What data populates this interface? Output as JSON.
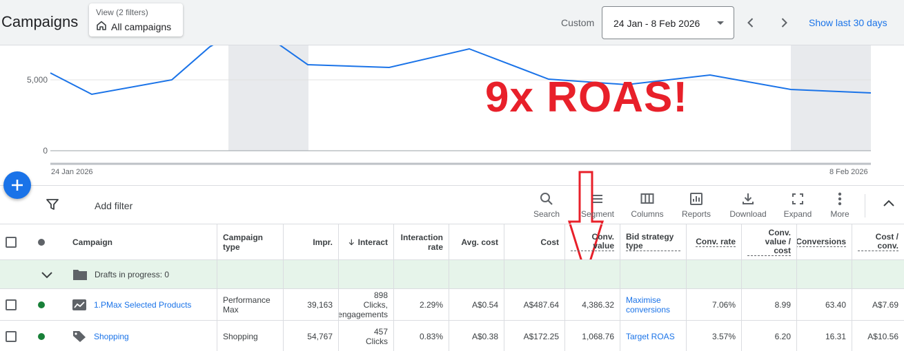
{
  "header": {
    "title": "Campaigns",
    "view_sub": "View (2 filters)",
    "view_main": "All campaigns",
    "custom_label": "Custom",
    "date_range": "24 Jan - 8 Feb 2026",
    "show_last": "Show last 30 days"
  },
  "chart": {
    "yticks": [
      "5,000",
      "0"
    ],
    "x_start": "24 Jan 2026",
    "x_end": "8 Feb 2026",
    "annotation": "9x ROAS!",
    "line_color": "#1a73e8",
    "annotation_color": "#e8202a"
  },
  "toolbar": {
    "add_filter": "Add filter",
    "tools": [
      {
        "label": "Search",
        "icon": "search-icon"
      },
      {
        "label": "Segment",
        "icon": "segment-icon"
      },
      {
        "label": "Columns",
        "icon": "columns-icon"
      },
      {
        "label": "Reports",
        "icon": "reports-icon"
      },
      {
        "label": "Download",
        "icon": "download-icon"
      },
      {
        "label": "Expand",
        "icon": "expand-icon"
      },
      {
        "label": "More",
        "icon": "more-icon"
      }
    ]
  },
  "table": {
    "headers": {
      "campaign": "Campaign",
      "campaign_type": "Campaign type",
      "impr": "Impr.",
      "interactions": "Interact",
      "interaction_rate": "Interaction rate",
      "avg_cost": "Avg. cost",
      "cost": "Cost",
      "conv_value": "Conv. value",
      "bid_strategy": "Bid strategy type",
      "conv_rate": "Conv. rate",
      "conv_value_cost": "Conv. value / cost",
      "conversions": "Conversions",
      "cost_conv": "Cost / conv."
    },
    "drafts": "Drafts in progress: 0",
    "rows": [
      {
        "campaign": "1.PMax Selected Products",
        "campaign_type": "Performance Max",
        "impr": "39,163",
        "interactions_count": "898",
        "interactions_unit": "Clicks,",
        "interactions_unit2": "engagements",
        "interaction_rate": "2.29%",
        "avg_cost": "A$0.54",
        "cost": "A$487.64",
        "conv_value": "4,386.32",
        "bid_strategy": "Maximise conversions",
        "conv_rate": "7.06%",
        "conv_value_cost": "8.99",
        "conversions": "63.40",
        "cost_conv": "A$7.69",
        "status_color": "#188038"
      },
      {
        "campaign": "Shopping",
        "campaign_type": "Shopping",
        "impr": "54,767",
        "interactions_count": "457",
        "interactions_unit": "Clicks",
        "interactions_unit2": "",
        "interaction_rate": "0.83%",
        "avg_cost": "A$0.38",
        "cost": "A$172.25",
        "conv_value": "1,068.76",
        "bid_strategy": "Target ROAS",
        "conv_rate": "3.57%",
        "conv_value_cost": "6.20",
        "conversions": "16.31",
        "cost_conv": "A$10.56",
        "status_color": "#188038"
      }
    ]
  }
}
